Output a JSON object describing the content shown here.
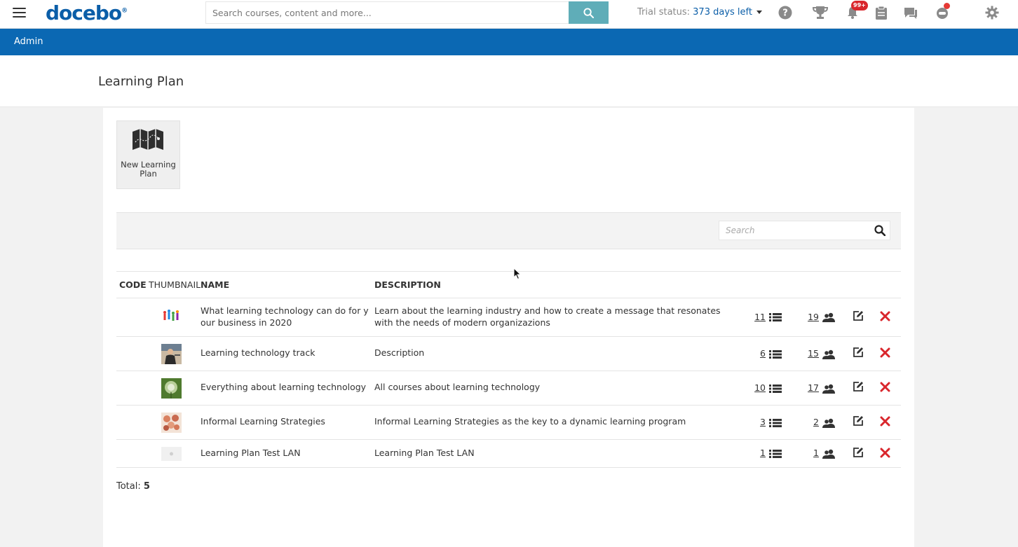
{
  "topbar": {
    "logo": "docebo",
    "logo_mark": "®",
    "search_placeholder": "Search courses, content and more...",
    "trial_prefix": "Trial status: ",
    "trial_days": "373 days left",
    "notifications_badge": "99+"
  },
  "adminbar": {
    "label": "Admin"
  },
  "page": {
    "title": "Learning Plan"
  },
  "tile": {
    "label": "New Learning Plan"
  },
  "filter": {
    "search_placeholder": "Search"
  },
  "table": {
    "headers": {
      "code": "CODE",
      "thumbnail": "THUMBNAIL",
      "name": "NAME",
      "description": "DESCRIPTION"
    },
    "rows": [
      {
        "code": "",
        "name": "What learning technology can do for your business in 2020",
        "description": "Learn about the learning industry and how to create a message that resonates with the needs of modern organizazions",
        "courses": "11",
        "users": "19",
        "thumb": "people-colorful"
      },
      {
        "code": "",
        "name": "Learning technology track",
        "description": "Description",
        "courses": "6",
        "users": "15",
        "thumb": "presenter-photo"
      },
      {
        "code": "",
        "name": "Everything about learning technology",
        "description": "All courses about learning technology",
        "courses": "10",
        "users": "17",
        "thumb": "dandelion-photo"
      },
      {
        "code": "",
        "name": "Informal Learning Strategies",
        "description": "Informal Learning Strategies as the key to a dynamic learning program",
        "courses": "3",
        "users": "2",
        "thumb": "group-hands-photo"
      },
      {
        "code": "",
        "name": "Learning Plan Test LAN",
        "description": "Learning Plan Test LAN",
        "courses": "1",
        "users": "1",
        "thumb": "placeholder-image"
      }
    ]
  },
  "footer": {
    "total_label": "Total: ",
    "total_value": "5"
  },
  "colors": {
    "brand_blue": "#0b68b3",
    "search_button": "#5fadb8",
    "delete_red": "#d9262c"
  }
}
